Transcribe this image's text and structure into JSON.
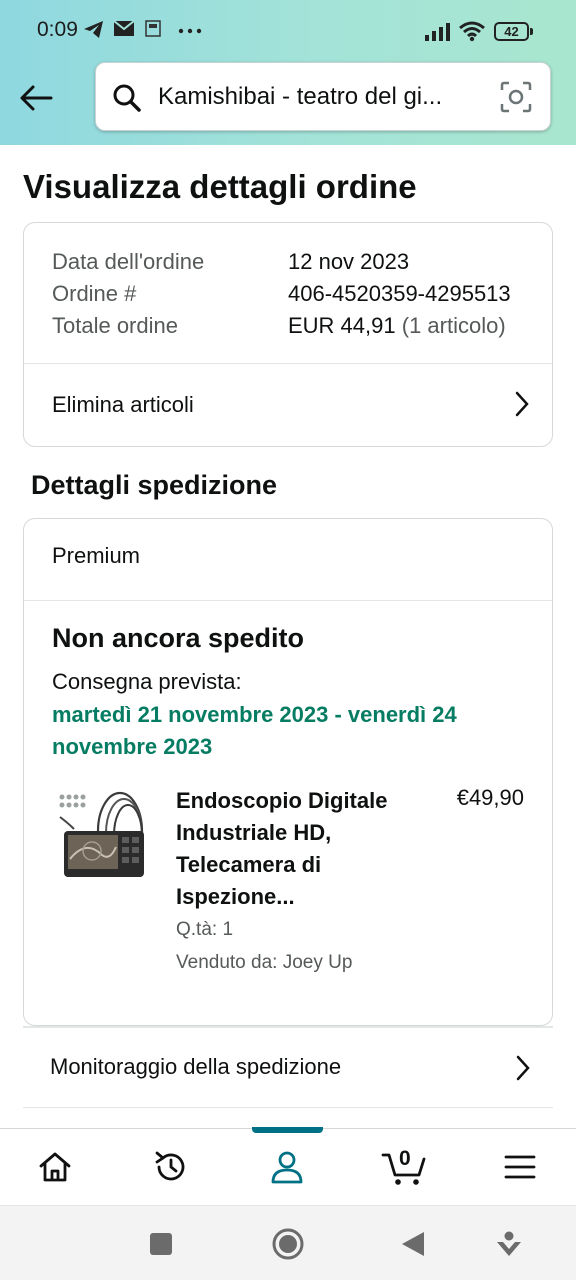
{
  "status_bar": {
    "time": "0:09",
    "battery": "42"
  },
  "search": {
    "query": "Kamishibai - teatro del gi..."
  },
  "page": {
    "title": "Visualizza dettagli ordine"
  },
  "order": {
    "date_label": "Data dell'ordine",
    "date_value": "12 nov 2023",
    "number_label": "Ordine #",
    "number_value": "406-4520359-4295513",
    "total_label": "Totale ordine",
    "total_value": "EUR 44,91",
    "total_items": "(1 articolo)",
    "remove_items_label": "Elimina articoli"
  },
  "shipment": {
    "heading": "Dettagli spedizione",
    "service": "Premium",
    "status": "Non ancora spedito",
    "delivery_label": "Consegna prevista:",
    "delivery_dates": "martedì 21 novembre 2023 - venerdì 24 novembre 2023",
    "delivery_color": "#067d62",
    "tracking_label": "Monitoraggio della spedizione"
  },
  "product": {
    "name": "Endoscopio Digitale Industriale HD, Telecamera di Ispezione...",
    "price": "€49,90",
    "quantity": "Q.tà: 1",
    "seller": "Venduto da: Joey Up",
    "image_icon": "endoscope-product-image"
  },
  "bottom_nav": {
    "active": "account",
    "accent_color": "#007185",
    "cart_count": "0",
    "items": [
      "home-icon",
      "history-icon",
      "account-icon",
      "cart-icon",
      "menu-icon"
    ]
  }
}
